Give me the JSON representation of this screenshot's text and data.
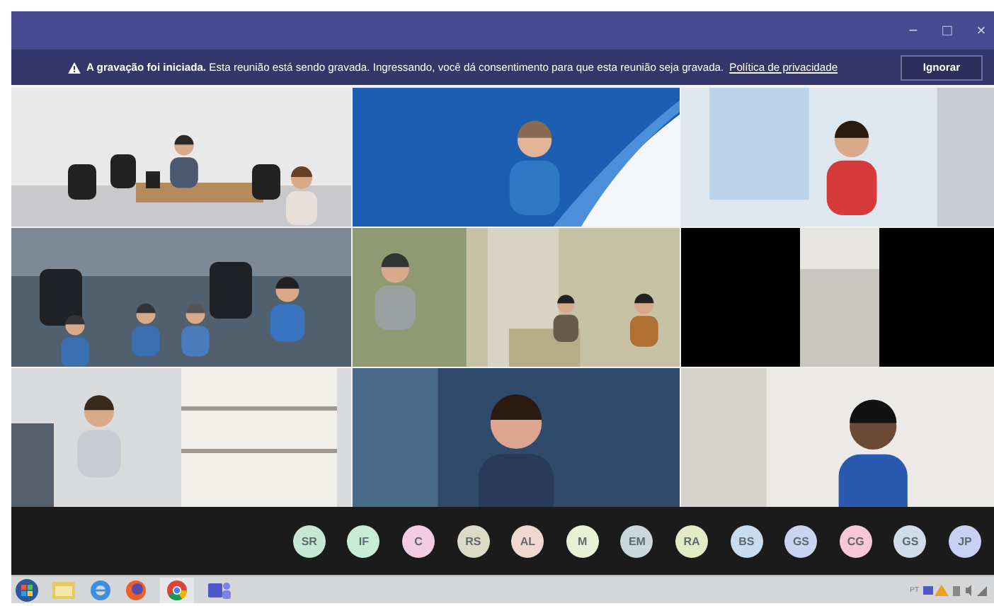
{
  "window": {
    "controls": [
      "−",
      "□",
      "×"
    ]
  },
  "banner": {
    "message": "**A gravação foi iniciada.** Esta reunião está sendo gravada. Ingressando, você dá consentimento para que esta reunião seja gravada.",
    "link": "Política de privacidade",
    "button": "Ignorar"
  },
  "tiles": [
    {
      "kind": "picture"
    },
    {
      "kind": "picture"
    },
    {
      "kind": "picture"
    },
    {
      "kind": "picture"
    },
    {
      "kind": "picture"
    },
    {
      "kind": "inset"
    },
    {
      "kind": "picture"
    },
    {
      "kind": "picture"
    },
    {
      "kind": "picture"
    }
  ],
  "participants": [
    {
      "initials": "SR",
      "color": "#c6e8d2"
    },
    {
      "initials": "IF",
      "color": "#c8ecd6"
    },
    {
      "initials": "C",
      "color": "#f2cce0"
    },
    {
      "initials": "RS",
      "color": "#dcdcc6"
    },
    {
      "initials": "AL",
      "color": "#f0d8d0"
    },
    {
      "initials": "M",
      "color": "#e8f0d6"
    },
    {
      "initials": "EM",
      "color": "#c8d8dc"
    },
    {
      "initials": "RA",
      "color": "#e2eac6"
    },
    {
      "initials": "BS",
      "color": "#c8dcf0"
    },
    {
      "initials": "GS",
      "color": "#c8d4f0"
    },
    {
      "initials": "CG",
      "color": "#f8c8d8"
    },
    {
      "initials": "GS",
      "color": "#d0dcea"
    },
    {
      "initials": "JP",
      "color": "#c8d0f4"
    }
  ],
  "taskbar": {
    "tray_text": "PT"
  }
}
